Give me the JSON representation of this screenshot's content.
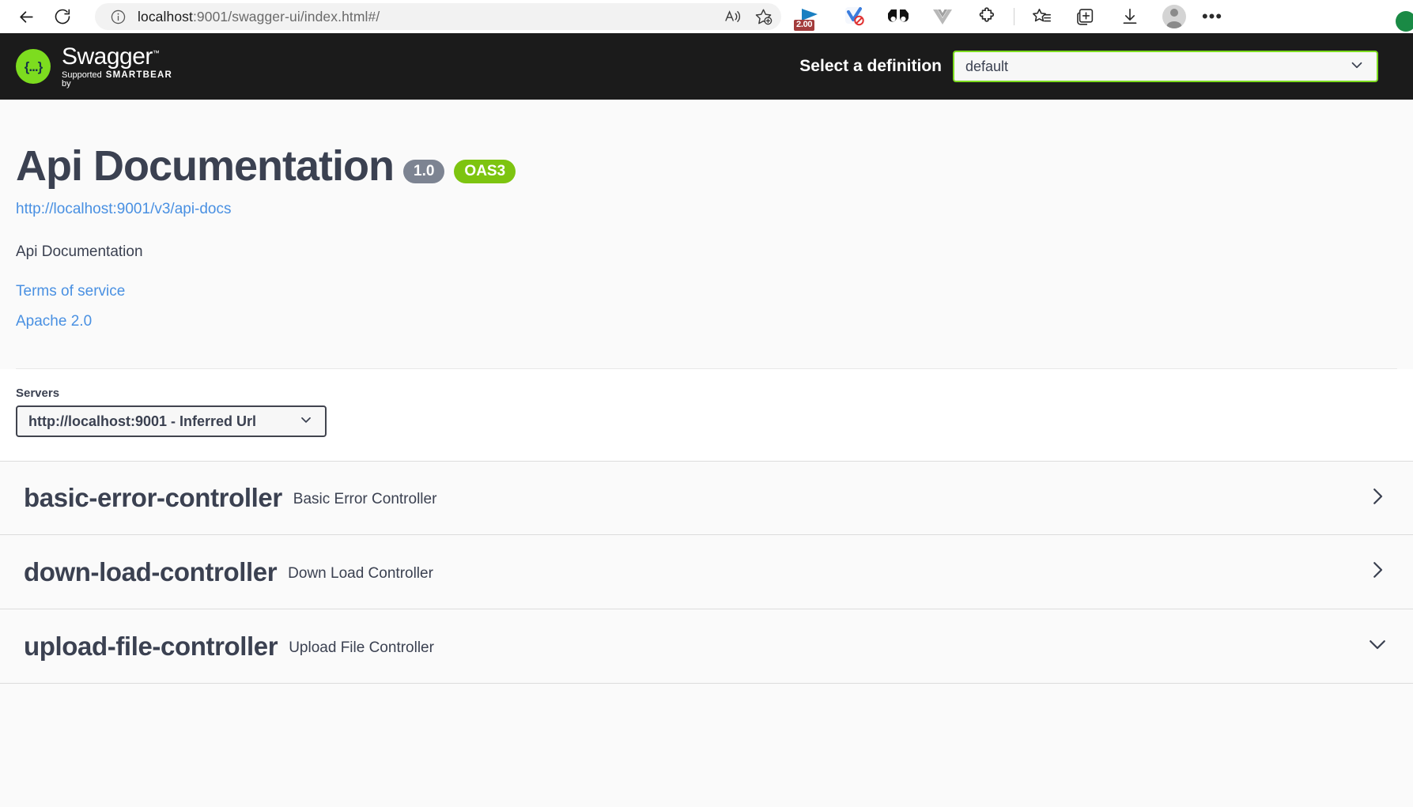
{
  "browser": {
    "back_icon": "back-arrow-icon",
    "reload_icon": "reload-icon",
    "site_info_icon": "site-information-icon",
    "url": "localhost:9001/swagger-ui/index.html#/",
    "url_host": "localhost",
    "url_path": ":9001/swagger-ui/index.html#/",
    "read_aloud_icon": "read-aloud-icon",
    "add_favorite_icon": "add-to-favorites-icon",
    "extensions": [
      {
        "name": "video-download-helper-icon",
        "badge": "2.00"
      },
      {
        "name": "adblock-icon",
        "badge": ""
      },
      {
        "name": "binoculars-extension-icon",
        "badge": ""
      },
      {
        "name": "vue-devtools-icon",
        "badge": ""
      },
      {
        "name": "extensions-puzzle-icon",
        "badge": ""
      }
    ],
    "collections_icon": "collections-icon",
    "split_screen_icon": "split-screen-icon",
    "downloads_icon": "downloads-icon",
    "profile_icon": "profile-avatar-icon",
    "settings_more_icon": "settings-and-more-icon"
  },
  "topbar": {
    "logo_glyph": "{...}",
    "logo_title": "Swagger",
    "logo_trademark": "™",
    "logo_supported_by": "Supported by",
    "logo_brand": "SMARTBEAR",
    "definition_label": "Select a definition",
    "definition_value": "default",
    "definition_options": [
      "default"
    ],
    "accent_green": "#7ddc1f"
  },
  "info": {
    "title": "Api Documentation",
    "version_badge": "1.0",
    "oas_badge": "OAS3",
    "docs_url": "http://localhost:9001/v3/api-docs",
    "description": "Api Documentation",
    "terms_link": "Terms of service",
    "license_link": "Apache 2.0"
  },
  "servers": {
    "label": "Servers",
    "selected": "http://localhost:9001 - Inferred Url",
    "options": [
      "http://localhost:9001 - Inferred Url"
    ]
  },
  "tags": [
    {
      "name": "basic-error-controller",
      "description": "Basic Error Controller",
      "expanded": false,
      "chevron": "chevron-right-icon"
    },
    {
      "name": "down-load-controller",
      "description": "Down Load Controller",
      "expanded": false,
      "chevron": "chevron-right-icon"
    },
    {
      "name": "upload-file-controller",
      "description": "Upload File Controller",
      "expanded": true,
      "chevron": "chevron-down-icon"
    }
  ],
  "colors": {
    "text_dark": "#3b4151",
    "link_blue": "#4990e2",
    "badge_gray": "#7d8492",
    "badge_green": "#7dc410",
    "topbar_black": "#1b1b1b"
  }
}
